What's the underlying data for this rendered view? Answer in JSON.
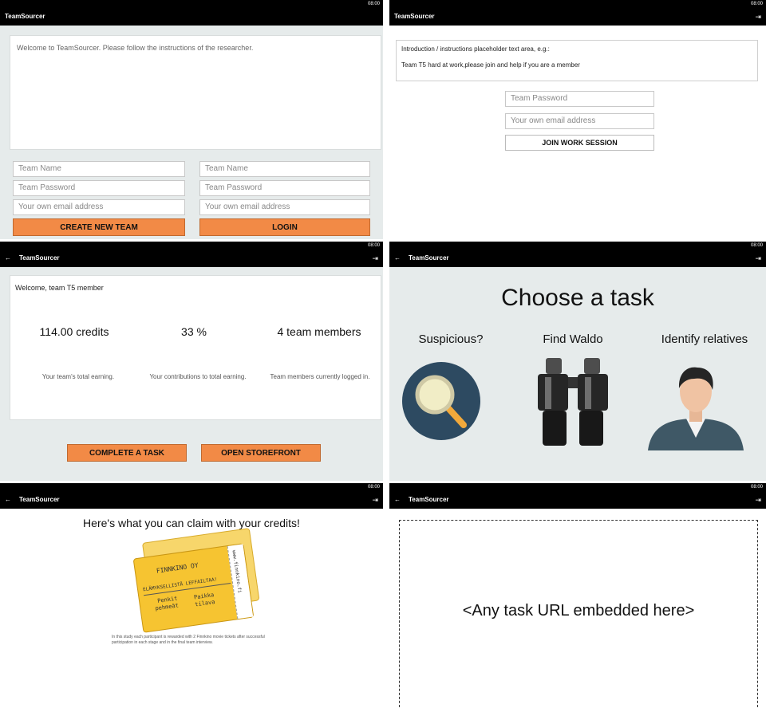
{
  "app": {
    "title": "TeamSourcer",
    "status_text": "08:00",
    "back_glyph": "←",
    "logout_glyph": "⇥"
  },
  "panel1": {
    "welcome": "Welcome to TeamSourcer. Please follow the instructions of the researcher.",
    "create": {
      "team_name": "Team Name",
      "team_password": "Team Password",
      "email": "Your own email address",
      "button": "CREATE NEW TEAM"
    },
    "login": {
      "team_name": "Team Name",
      "team_password": "Team Password",
      "email": "Your own email address",
      "button": "LOGIN"
    }
  },
  "panel2": {
    "intro_line1": "Introduction / instructions placeholder text area, e.g.:",
    "intro_line2": "Team T5 hard at work,please join and help if you are a member",
    "team_password": "Team Password",
    "email": "Your own email address",
    "button": "JOIN WORK SESSION"
  },
  "panel3": {
    "welcome": "Welcome, team T5 member",
    "stats": [
      {
        "value": "114.00 credits",
        "caption": "Your team's total earning."
      },
      {
        "value": "33 %",
        "caption": "Your contributions to total earning."
      },
      {
        "value": "4 team members",
        "caption": "Team members currently logged in."
      }
    ],
    "complete_button": "COMPLETE A TASK",
    "storefront_button": "OPEN STOREFRONT"
  },
  "panel4": {
    "heading": "Choose a task",
    "tasks": [
      {
        "label": "Suspicious?",
        "icon": "magnifier-icon"
      },
      {
        "label": "Find Waldo",
        "icon": "binoculars-icon"
      },
      {
        "label": "Identify relatives",
        "icon": "person-icon"
      }
    ]
  },
  "panel5": {
    "heading": "Here's what you can claim with your credits!",
    "ticket": {
      "brand": "FINNKINO OY",
      "slogan": "ELÄMYKSELLISTÄ LEFFAILTAA!",
      "left1": "Penkit",
      "left2": "pehmeät",
      "right1": "Paikka",
      "right2": "tilava",
      "url": "www.finnkino.fi"
    },
    "footnote_line1": "In this study each participant is rewarded with 2 Finnkino movie tickets after successful",
    "footnote_line2": "participation in each stage and in the final team interview."
  },
  "panel6": {
    "placeholder": "<Any task URL embedded here>"
  },
  "colors": {
    "accent": "#f28a46",
    "bar": "#000000",
    "background": "#e6ebeb"
  }
}
